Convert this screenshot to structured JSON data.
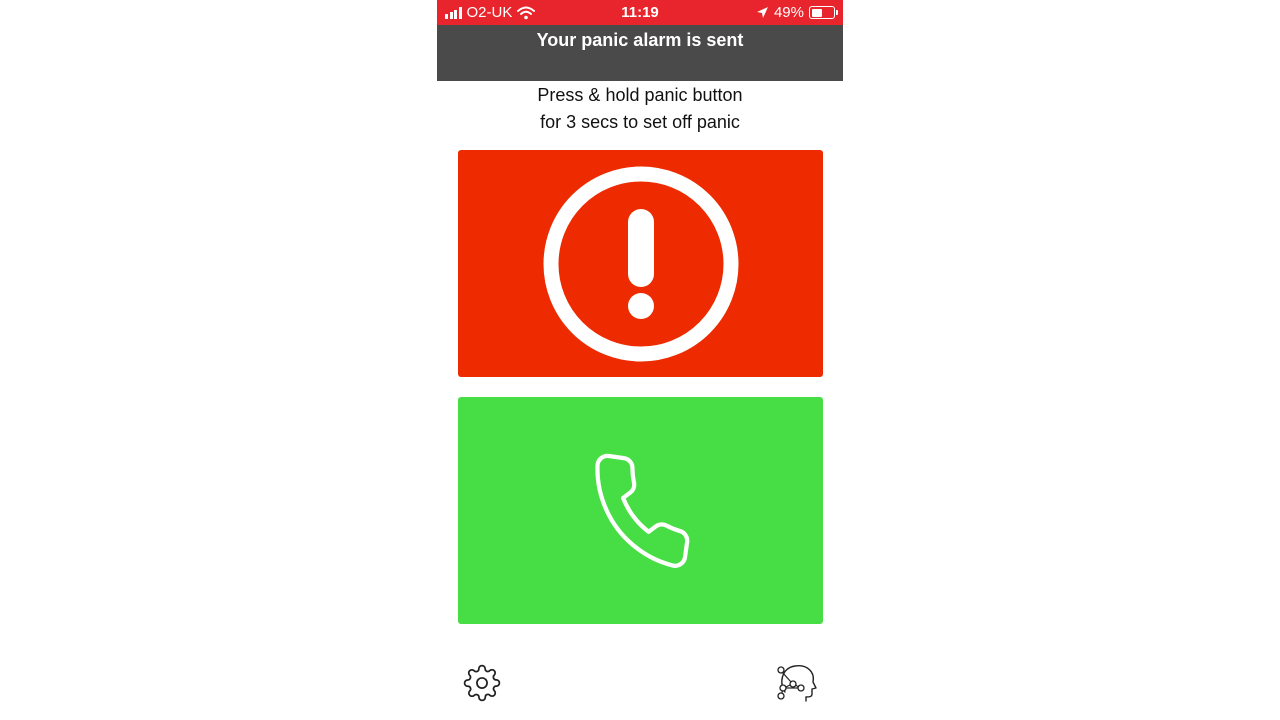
{
  "status_bar": {
    "carrier": "O2-UK",
    "time": "11:19",
    "battery_percent": "49%",
    "battery_level": 0.49,
    "color": "#e8242c"
  },
  "banner": {
    "message": "Your panic alarm is sent",
    "color": "#4a4a4a"
  },
  "instructions": {
    "line1": "Press & hold panic button",
    "line2": "for 3 secs to set off panic"
  },
  "panic_button": {
    "icon": "exclamation-circle-icon",
    "color": "#ee2b00"
  },
  "call_button": {
    "icon": "phone-icon",
    "color": "#47dd44"
  },
  "bottom_bar": {
    "left_icon": "gear-icon",
    "right_icon": "head-network-icon"
  }
}
